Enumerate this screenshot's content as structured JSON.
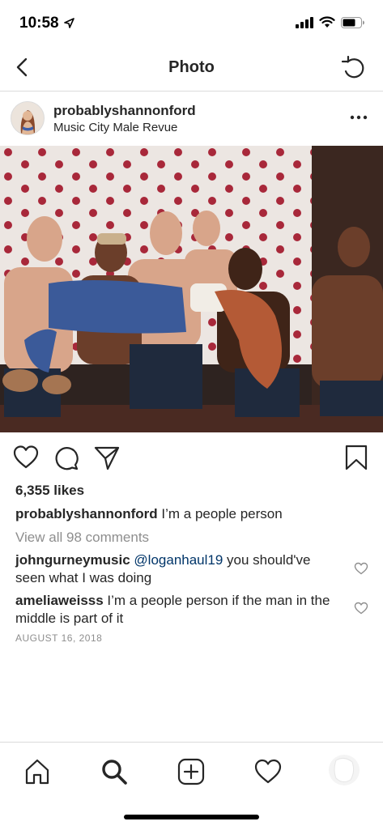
{
  "status_bar": {
    "time": "10:58"
  },
  "nav": {
    "title": "Photo"
  },
  "post": {
    "username": "probablyshannonford",
    "location": "Music City Male Revue",
    "likes": "6,355 likes",
    "caption_text": " I’m a people person",
    "view_all": "View all 98 comments",
    "comments": [
      {
        "user": "johngurneymusic",
        "mention": "@loganhaul19",
        "text": " you should've seen what I was doing"
      },
      {
        "user": "ameliaweisss",
        "mention": "",
        "text": " I’m a people person if the man in the middle is part of it"
      }
    ],
    "date": "AUGUST 16, 2018"
  },
  "icons": {
    "status": [
      "location-arrow-icon",
      "signal-bars-icon",
      "wifi-icon",
      "battery-icon"
    ],
    "nav": [
      "back-chevron-icon",
      "refresh-icon"
    ],
    "actions": [
      "heart-icon",
      "comment-icon",
      "share-icon",
      "bookmark-icon"
    ],
    "tabs": [
      "home-icon",
      "search-icon",
      "add-post-icon",
      "activity-heart-icon",
      "profile-avatar-icon"
    ]
  }
}
